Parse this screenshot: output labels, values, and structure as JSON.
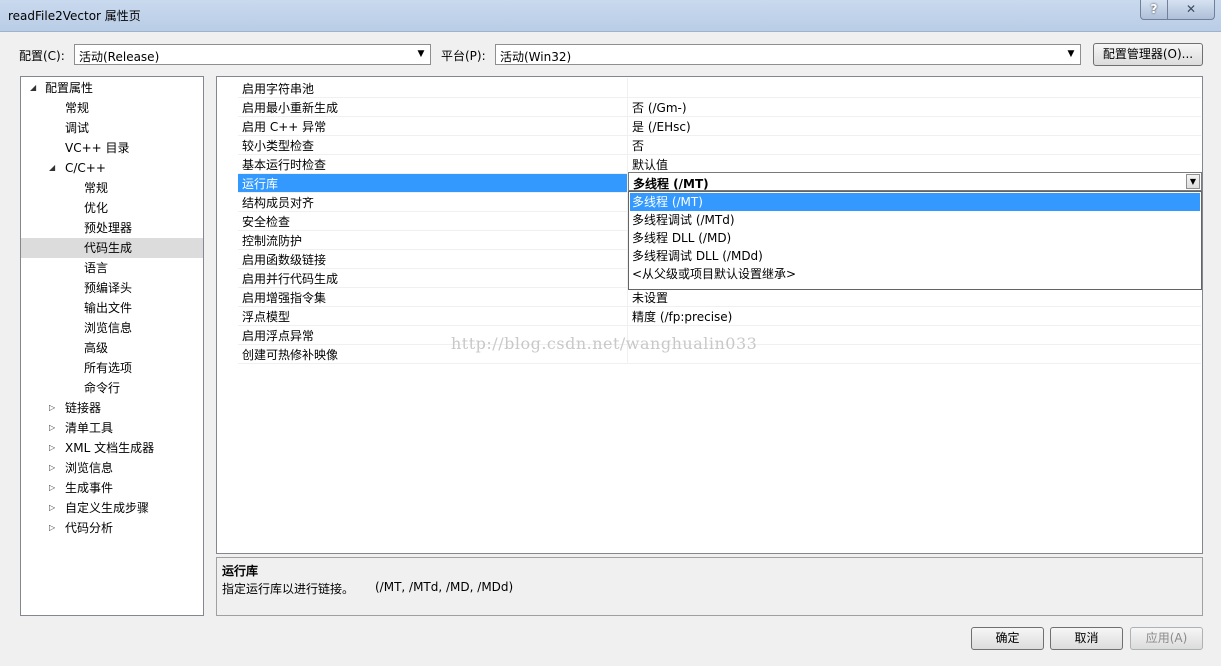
{
  "window": {
    "title": "readFile2Vector 属性页",
    "help_label": "?",
    "close_label": "✕"
  },
  "toolbar": {
    "config_label": "配置(C):",
    "config_value": "活动(Release)",
    "platform_label": "平台(P):",
    "platform_value": "活动(Win32)",
    "config_manager_label": "配置管理器(O)..."
  },
  "tree": {
    "items": [
      {
        "label": "配置属性",
        "expander": "◢"
      },
      {
        "label": "常规",
        "expander": ""
      },
      {
        "label": "调试",
        "expander": ""
      },
      {
        "label": "VC++ 目录",
        "expander": ""
      },
      {
        "label": "C/C++",
        "expander": "◢"
      },
      {
        "label": "常规",
        "expander": ""
      },
      {
        "label": "优化",
        "expander": ""
      },
      {
        "label": "预处理器",
        "expander": ""
      },
      {
        "label": "代码生成",
        "expander": ""
      },
      {
        "label": "语言",
        "expander": ""
      },
      {
        "label": "预编译头",
        "expander": ""
      },
      {
        "label": "输出文件",
        "expander": ""
      },
      {
        "label": "浏览信息",
        "expander": ""
      },
      {
        "label": "高级",
        "expander": ""
      },
      {
        "label": "所有选项",
        "expander": ""
      },
      {
        "label": "命令行",
        "expander": ""
      },
      {
        "label": "链接器",
        "expander": "▷"
      },
      {
        "label": "清单工具",
        "expander": "▷"
      },
      {
        "label": "XML 文档生成器",
        "expander": "▷"
      },
      {
        "label": "浏览信息",
        "expander": "▷"
      },
      {
        "label": "生成事件",
        "expander": "▷"
      },
      {
        "label": "自定义生成步骤",
        "expander": "▷"
      },
      {
        "label": "代码分析",
        "expander": "▷"
      }
    ]
  },
  "properties": [
    {
      "name": "启用字符串池",
      "value": ""
    },
    {
      "name": "启用最小重新生成",
      "value": "否 (/Gm-)"
    },
    {
      "name": "启用 C++ 异常",
      "value": "是 (/EHsc)"
    },
    {
      "name": "较小类型检查",
      "value": "否"
    },
    {
      "name": "基本运行时检查",
      "value": "默认值"
    },
    {
      "name": "运行库",
      "value": "多线程 (/MT)"
    },
    {
      "name": "结构成员对齐",
      "value": ""
    },
    {
      "name": "安全检查",
      "value": ""
    },
    {
      "name": "控制流防护",
      "value": ""
    },
    {
      "name": "启用函数级链接",
      "value": ""
    },
    {
      "name": "启用并行代码生成",
      "value": ""
    },
    {
      "name": "启用增强指令集",
      "value": "未设置"
    },
    {
      "name": "浮点模型",
      "value": "精度 (/fp:precise)"
    },
    {
      "name": "启用浮点异常",
      "value": ""
    },
    {
      "name": "创建可热修补映像",
      "value": ""
    }
  ],
  "runtime_dropdown": {
    "selected": "多线程 (/MT)",
    "options": [
      "多线程 (/MT)",
      "多线程调试 (/MTd)",
      "多线程 DLL (/MD)",
      "多线程调试 DLL (/MDd)",
      "<从父级或项目默认设置继承>"
    ]
  },
  "watermark": "http://blog.csdn.net/wanghualin033",
  "description": {
    "title": "运行库",
    "text": "指定运行库以进行链接。",
    "switches": "(/MT, /MTd, /MD, /MDd)"
  },
  "buttons": {
    "ok": "确定",
    "cancel": "取消",
    "apply": "应用(A)"
  }
}
